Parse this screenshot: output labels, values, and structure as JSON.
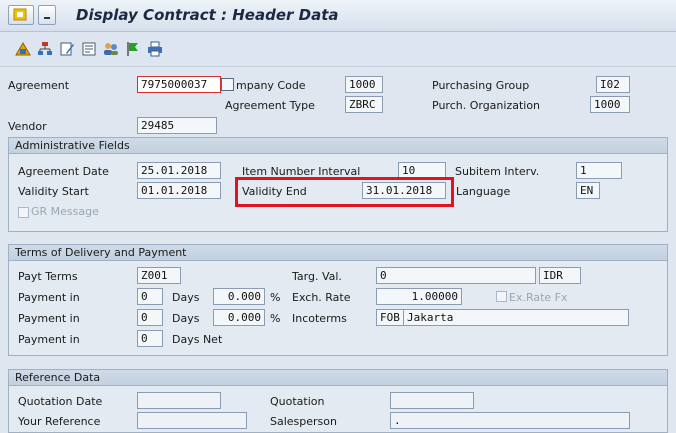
{
  "window": {
    "title": "Display Contract : Header Data"
  },
  "toolbar": {
    "icons": [
      "account-assignment-icon",
      "hierarchy-icon",
      "edit-icon",
      "text-icon",
      "partners-icon",
      "flag-icon",
      "print-icon"
    ]
  },
  "header": {
    "agreement_label": "Agreement",
    "agreement_value": "7975000037",
    "company_code_label": "mpany Code",
    "company_code_value": "1000",
    "agreement_type_label": "Agreement Type",
    "agreement_type_value": "ZBRC",
    "purchasing_group_label": "Purchasing Group",
    "purchasing_group_value": "I02",
    "purch_org_label": "Purch. Organization",
    "purch_org_value": "1000",
    "vendor_label": "Vendor",
    "vendor_value": "29485"
  },
  "admin": {
    "title": "Administrative Fields",
    "agreement_date_label": "Agreement Date",
    "agreement_date_value": "25.01.2018",
    "item_interval_label": "Item Number Interval",
    "item_interval_value": "10",
    "subitem_interval_label": "Subitem Interv.",
    "subitem_interval_value": "1",
    "validity_start_label": "Validity Start",
    "validity_start_value": "01.01.2018",
    "validity_end_label": "Validity End",
    "validity_end_value": "31.01.2018",
    "language_label": "Language",
    "language_value": "EN",
    "gr_message_label": "GR Message"
  },
  "terms": {
    "title": "Terms of Delivery and Payment",
    "payt_terms_label": "Payt Terms",
    "payt_terms_value": "Z001",
    "payment_in_label": "Payment in",
    "days_label": "Days",
    "days_net_label": "Days Net",
    "percent_label": "%",
    "row1_days": "0",
    "row1_pct": "0.000",
    "row2_days": "0",
    "row2_pct": "0.000",
    "row3_days": "0",
    "targ_val_label": "Targ. Val.",
    "targ_val_value": "0",
    "currency_value": "IDR",
    "exch_rate_label": "Exch. Rate",
    "exch_rate_value": "1.00000",
    "ex_rate_fx_label": "Ex.Rate Fx",
    "incoterms_label": "Incoterms",
    "incoterms_code": "FOB",
    "incoterms_place": "Jakarta"
  },
  "reference": {
    "title": "Reference Data",
    "quotation_date_label": "Quotation Date",
    "quotation_label": "Quotation",
    "your_reference_label": "Your Reference",
    "salesperson_label": "Salesperson",
    "salesperson_value": "."
  },
  "colors": {
    "highlight": "#e0141e",
    "title_text": "#1b2a40",
    "background": "#dfe6ef"
  }
}
